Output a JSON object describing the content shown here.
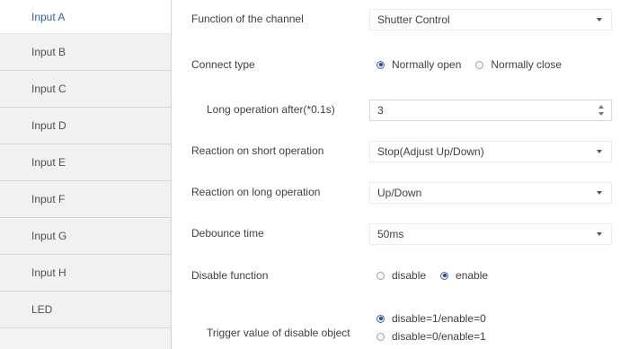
{
  "sidebar": {
    "items": [
      {
        "label": "Input A",
        "active": true
      },
      {
        "label": "Input B",
        "active": false
      },
      {
        "label": "Input C",
        "active": false
      },
      {
        "label": "Input D",
        "active": false
      },
      {
        "label": "Input E",
        "active": false
      },
      {
        "label": "Input F",
        "active": false
      },
      {
        "label": "Input G",
        "active": false
      },
      {
        "label": "Input H",
        "active": false
      },
      {
        "label": "LED",
        "active": false
      }
    ]
  },
  "settings": {
    "function": {
      "label": "Function of the channel",
      "value": "Shutter Control"
    },
    "connect_type": {
      "label": "Connect type",
      "options": [
        {
          "label": "Normally open",
          "checked": true
        },
        {
          "label": "Normally close",
          "checked": false
        }
      ]
    },
    "long_operation": {
      "label": "Long operation after(*0.1s)",
      "value": "3"
    },
    "short_reaction": {
      "label": "Reaction on short operation",
      "value": "Stop(Adjust Up/Down)"
    },
    "long_reaction": {
      "label": "Reaction on long operation",
      "value": "Up/Down"
    },
    "debounce": {
      "label": "Debounce time",
      "value": "50ms"
    },
    "disable_function": {
      "label": "Disable function",
      "options": [
        {
          "label": "disable",
          "checked": false
        },
        {
          "label": "enable",
          "checked": true
        }
      ]
    },
    "trigger_value": {
      "label": "Trigger value of disable object",
      "options": [
        {
          "label": "disable=1/enable=0",
          "checked": true
        },
        {
          "label": "disable=0/enable=1",
          "checked": false
        }
      ]
    }
  },
  "colors": {
    "active_tab_text": "#2f5fa6",
    "sidebar_bg": "#f1f1f1",
    "radio_checked": "#2b4f84"
  }
}
